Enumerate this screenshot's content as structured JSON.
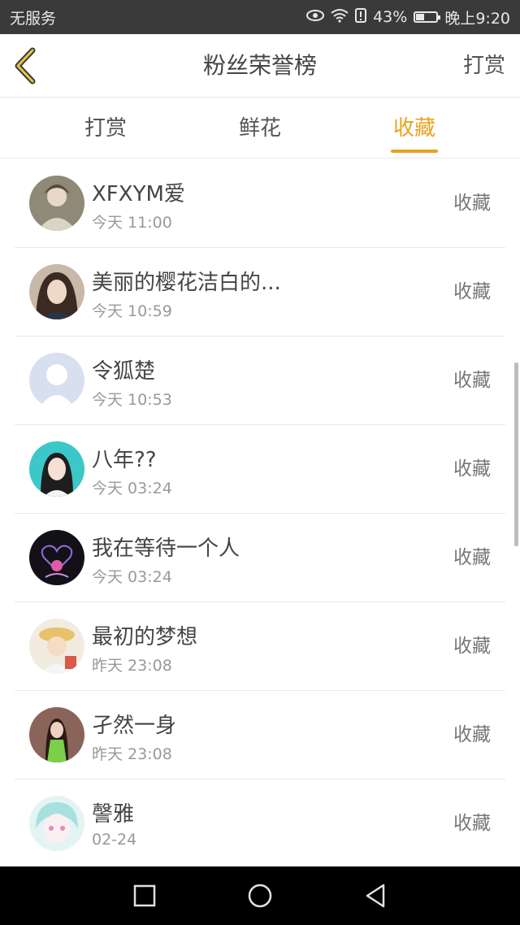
{
  "status_bar": {
    "carrier": "无服务",
    "battery_percent": "43%",
    "battery_level": 0.43,
    "time": "晚上9:20",
    "icons": [
      "eye-icon",
      "wifi-icon",
      "alert-icon",
      "battery-icon"
    ]
  },
  "header": {
    "title": "粉丝荣誉榜",
    "action_label": "打赏",
    "back_icon": "chevron-left-icon",
    "accent_color": "#e9a21f"
  },
  "tabs": [
    {
      "label": "打赏",
      "active": false
    },
    {
      "label": "鲜花",
      "active": false
    },
    {
      "label": "收藏",
      "active": true
    }
  ],
  "list": [
    {
      "name": "XFXYM爱",
      "time": "今天 11:00",
      "action": "收藏"
    },
    {
      "name": "美丽的樱花洁白的...",
      "time": "今天 10:59",
      "action": "收藏"
    },
    {
      "name": "令狐楚",
      "time": "今天 10:53",
      "action": "收藏"
    },
    {
      "name": "八年??",
      "time": "今天 03:24",
      "action": "收藏"
    },
    {
      "name": "我在等待一个人",
      "time": "今天 03:24",
      "action": "收藏"
    },
    {
      "name": "最初的梦想",
      "time": "昨天 23:08",
      "action": "收藏"
    },
    {
      "name": "孑然一身",
      "time": "昨天 23:08",
      "action": "收藏"
    },
    {
      "name": "謦雅",
      "time": "02-24",
      "action": "收藏"
    }
  ],
  "nav_bar": {
    "icons": [
      "recent-apps-icon",
      "home-icon",
      "back-icon"
    ]
  }
}
